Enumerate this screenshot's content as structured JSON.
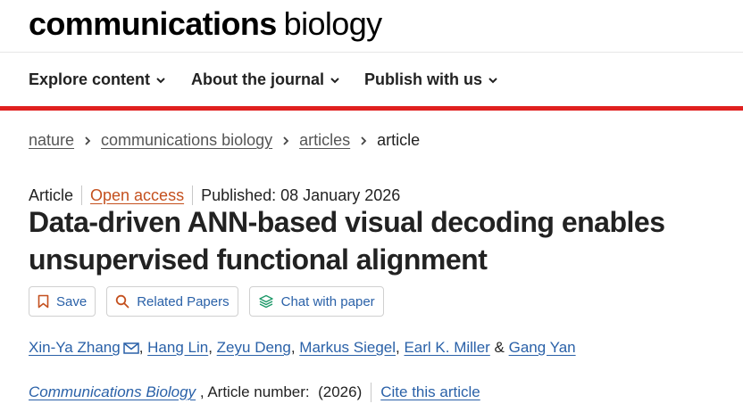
{
  "header": {
    "logo_bold": "communications",
    "logo_light": "biology"
  },
  "nav": {
    "items": [
      {
        "label": "Explore content"
      },
      {
        "label": "About the journal"
      },
      {
        "label": "Publish with us"
      }
    ]
  },
  "breadcrumb": {
    "items": [
      "nature",
      "communications biology",
      "articles"
    ],
    "current": "article"
  },
  "article": {
    "type": "Article",
    "access": "Open access",
    "published": "Published: 08 January 2026",
    "title": "Data-driven ANN-based visual decoding enables unsupervised functional alignment",
    "actions": {
      "save": "Save",
      "related": "Related Papers",
      "chat": "Chat with paper"
    },
    "authors": [
      "Xin-Ya Zhang",
      "Hang Lin",
      "Zeyu Deng",
      "Markus Siegel",
      "Earl K. Miller",
      "Gang Yan"
    ],
    "author_separators": [
      ", ",
      ", ",
      ", ",
      ", ",
      " & "
    ],
    "citation": {
      "journal": "Communications Biology",
      "details": " , Article number:  (2026)",
      "cite_link": "Cite this article"
    }
  },
  "colors": {
    "accent_red": "#e0201f",
    "link_blue": "#2a61a8",
    "open_access_orange": "#c4501e"
  }
}
